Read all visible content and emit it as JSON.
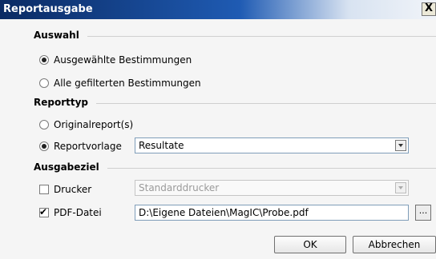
{
  "window": {
    "title": "Reportausgabe",
    "close_symbol": "X"
  },
  "auswahl": {
    "heading": "Auswahl",
    "options": [
      {
        "label": "Ausgewählte Bestimmungen",
        "checked": true
      },
      {
        "label": "Alle gefilterten Bestimmungen",
        "checked": false
      }
    ]
  },
  "reporttyp": {
    "heading": "Reporttyp",
    "options": [
      {
        "label": "Originalreport(s)",
        "checked": false
      },
      {
        "label": "Reportvorlage",
        "checked": true
      }
    ],
    "vorlage_value": "Resultate"
  },
  "ausgabeziel": {
    "heading": "Ausgabeziel",
    "drucker": {
      "label": "Drucker",
      "checked": false,
      "value": "Standarddrucker",
      "enabled": false
    },
    "pdf": {
      "label": "PDF-Datei",
      "checked": true,
      "value": "D:\\Eigene Dateien\\MagIC\\Probe.pdf",
      "browse_label": "..."
    }
  },
  "buttons": {
    "ok": "OK",
    "cancel": "Abbrechen"
  },
  "colors": {
    "titlebar_start": "#0a2a63",
    "titlebar_mid": "#1f5bb3",
    "dialog_bg": "#f5f5f5",
    "field_border": "#7f9db9"
  }
}
